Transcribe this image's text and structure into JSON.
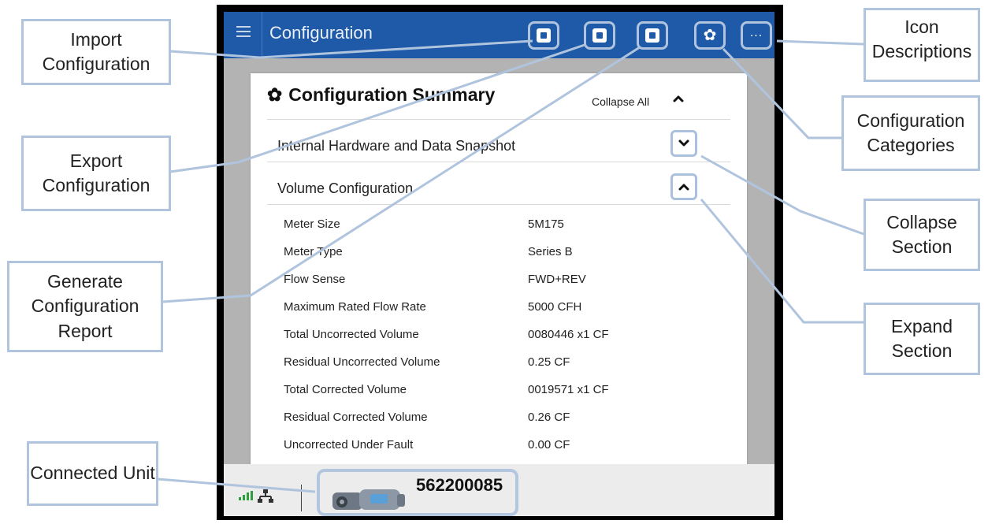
{
  "app": {
    "title": "Configuration"
  },
  "toolbar": {
    "menu_icon": "hamburger-icon",
    "buttons": [
      {
        "name": "import",
        "icon": "import-file-icon"
      },
      {
        "name": "export",
        "icon": "export-file-icon"
      },
      {
        "name": "report",
        "icon": "report-file-icon"
      },
      {
        "name": "categories",
        "icon": "gear-icon"
      },
      {
        "name": "more",
        "icon": "more-dots-icon"
      }
    ]
  },
  "summary": {
    "title": "Configuration Summary",
    "collapse_all_label": "Collapse All",
    "sections": [
      {
        "title": "Internal Hardware and Data Snapshot",
        "state": "collapsed"
      },
      {
        "title": "Volume Configuration",
        "state": "expanded"
      }
    ],
    "rows": [
      {
        "label": "Meter Size",
        "value": "5M175"
      },
      {
        "label": "Meter Type",
        "value": "Series B"
      },
      {
        "label": "Flow Sense",
        "value": "FWD+REV"
      },
      {
        "label": "Maximum Rated Flow Rate",
        "value": "5000 CFH"
      },
      {
        "label": "Total Uncorrected Volume",
        "value": "0080446 x1 CF"
      },
      {
        "label": "Residual Uncorrected Volume",
        "value": "0.25 CF"
      },
      {
        "label": "Total Corrected Volume",
        "value": "0019571 x1 CF"
      },
      {
        "label": "Residual Corrected Volume",
        "value": "0.26 CF"
      },
      {
        "label": "Uncorrected Under Fault",
        "value": "0.00 CF"
      }
    ]
  },
  "footer": {
    "unit_number": "562200085"
  },
  "callouts": {
    "import": "Import Configuration",
    "export": "Export Configuration",
    "report": "Generate Configuration Report",
    "connected": "Connected Unit",
    "icon_desc": "Icon Descriptions",
    "categories": "Configuration Categories",
    "collapse": "Collapse Section",
    "expand": "Expand Section"
  },
  "colors": {
    "titlebar": "#1e5aa8",
    "callout_border": "#b0c4de",
    "signal": "#2e9e3e"
  }
}
